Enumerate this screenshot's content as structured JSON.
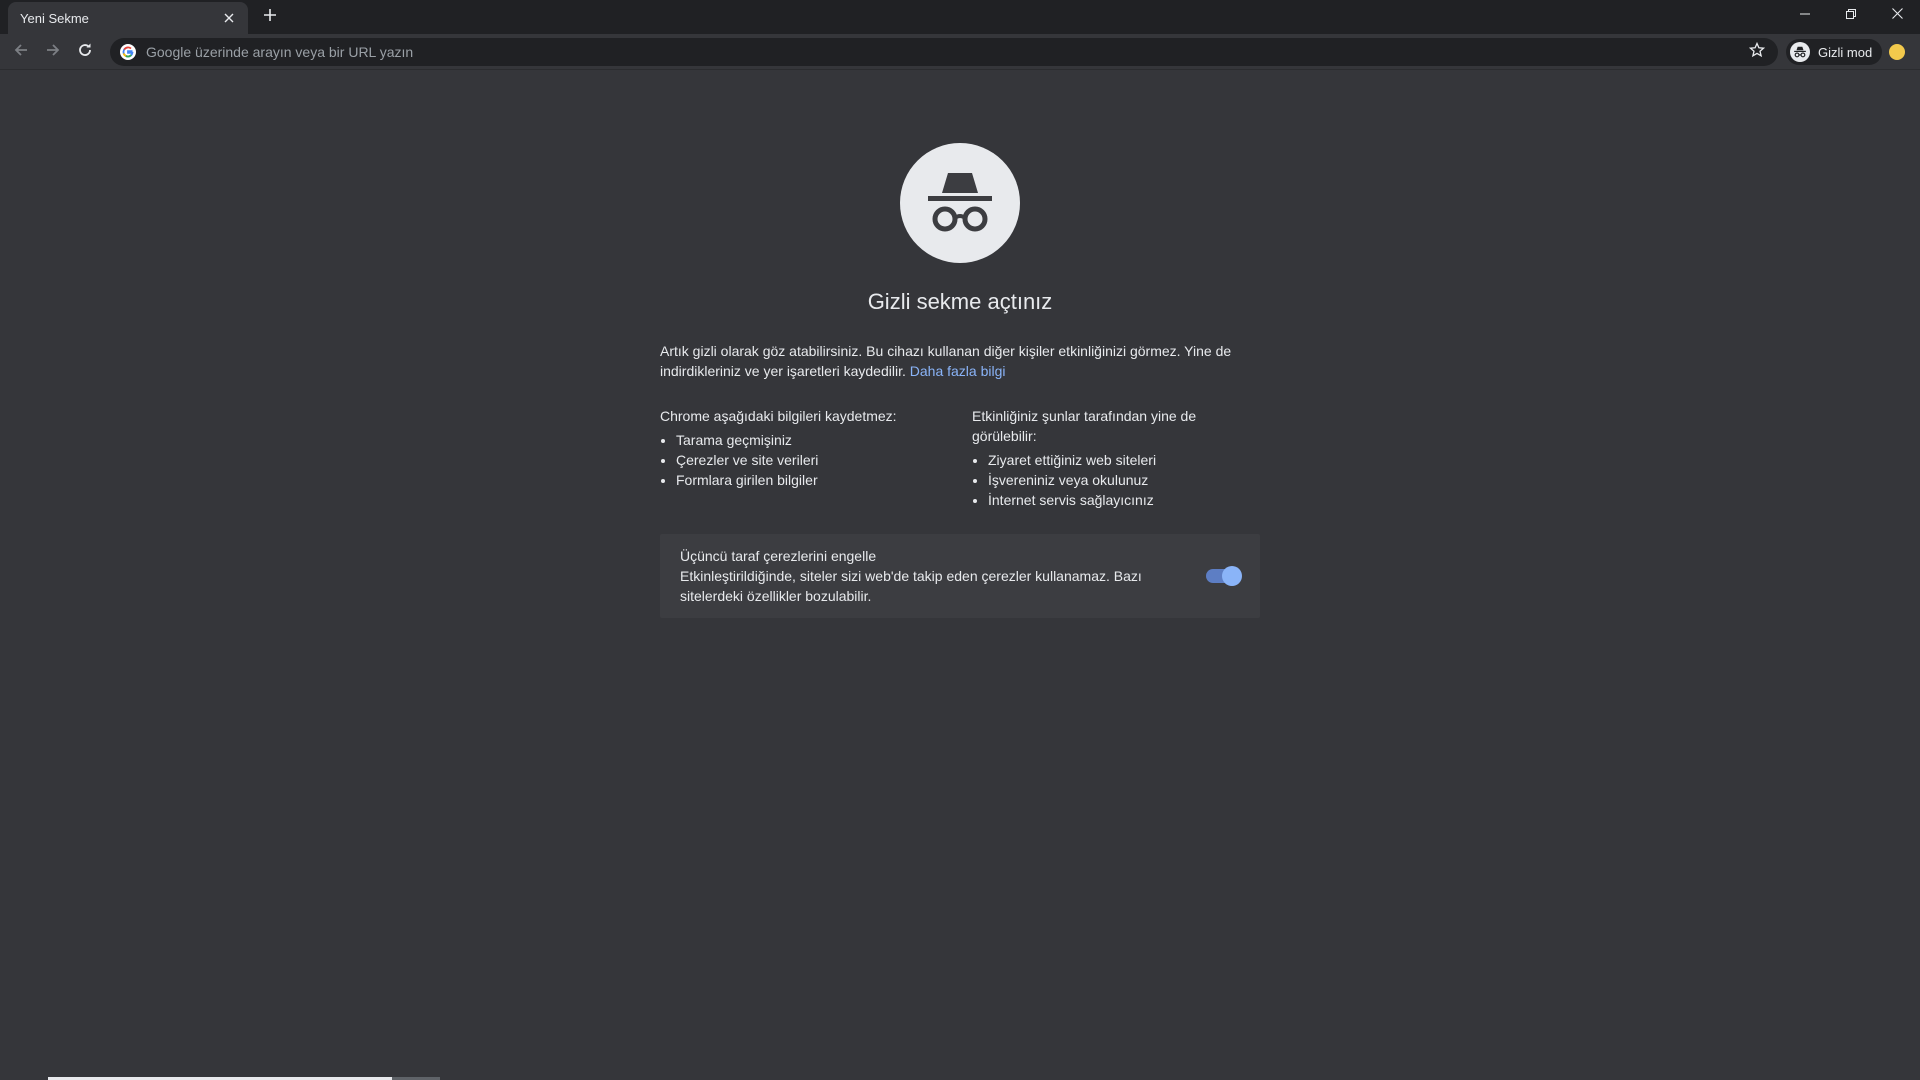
{
  "tab": {
    "title": "Yeni Sekme"
  },
  "toolbar": {
    "omnibox_placeholder": "Google üzerinde arayın veya bir URL yazın",
    "profile_label": "Gizli mod"
  },
  "incognito": {
    "title": "Gizli sekme açtınız",
    "intro_text": "Artık gizli olarak göz atabilirsiniz. Bu cihazı kullanan diğer kişiler etkinliğinizi görmez. Yine de indirdikleriniz ve yer işaretleri kaydedilir.",
    "learn_more": "Daha fazla bilgi",
    "not_saved_heading": "Chrome aşağıdaki bilgileri kaydetmez:",
    "not_saved_items": [
      "Tarama geçmişiniz",
      "Çerezler ve site verileri",
      "Formlara girilen bilgiler"
    ],
    "visible_heading": "Etkinliğiniz şunlar tarafından yine de görülebilir:",
    "visible_items": [
      "Ziyaret ettiğiniz web siteleri",
      "İşvereniniz veya okulunuz",
      "İnternet servis sağlayıcınız"
    ],
    "cookie_title": "Üçüncü taraf çerezlerini engelle",
    "cookie_desc": "Etkinleştirildiğinde, siteler sizi web'de takip eden çerezler kullanamaz. Bazı sitelerdeki özellikler bozulabilir.",
    "cookie_toggle_on": true
  },
  "icons": {
    "tab_close": "close-icon",
    "new_tab": "plus-icon",
    "minimize": "minimize-icon",
    "restore": "restore-icon",
    "close": "close-icon",
    "back": "arrow-left-icon",
    "forward": "arrow-right-icon",
    "reload": "reload-icon",
    "search_engine": "google-icon",
    "bookmark": "star-icon",
    "incognito": "incognito-icon"
  },
  "colors": {
    "frame": "#202124",
    "background": "#35363a",
    "link": "#8ab4f8",
    "toggle": "#8ab4f8"
  }
}
